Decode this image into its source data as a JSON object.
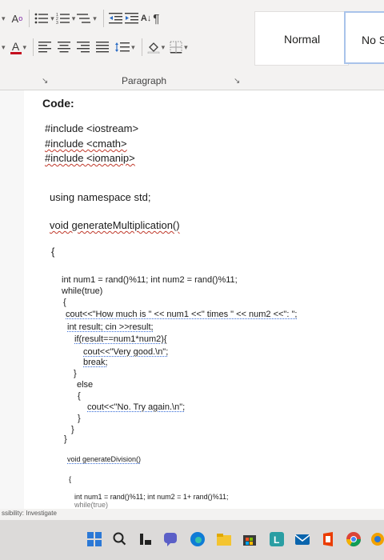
{
  "ribbon": {
    "styles": [
      "Normal",
      "No S"
    ],
    "group_label": "Paragraph",
    "dialog_launcher": "↘",
    "icons": {
      "bullets": "bullets-icon",
      "numbering": "numbering-icon",
      "multilevel": "multilevel-list-icon",
      "decrease_indent": "decrease-indent-icon",
      "increase_indent": "increase-indent-icon",
      "sort": "sort-icon",
      "pilcrow": "show-formatting-icon",
      "align_left": "align-left-icon",
      "center": "align-center-icon",
      "align_right": "align-right-icon",
      "justify": "justify-icon",
      "line_spacing": "line-spacing-icon",
      "shading": "shading-icon",
      "borders": "borders-icon"
    },
    "glyphs": {
      "phonetic": "A",
      "font_color": "A",
      "sort": "A↓",
      "pilcrow": "¶"
    }
  },
  "document": {
    "heading": "Code:",
    "lines": [
      "#include <iostream>",
      "#include <cmath>",
      "#include <iomanip>",
      "using namespace std;",
      "void generateMultiplication()",
      "{",
      "int num1 = rand()%11; int num2 = rand()%11;",
      "while(true)",
      "{",
      "cout<<\"How much is \" << num1 <<\" times \" << num2 <<\": \";",
      "int result; cin >>result;",
      "if(result==num1*num2){",
      "cout<<\"Very good.\\n\";",
      "break;",
      "}",
      "else",
      "{",
      "cout<<\"No. Try again.\\n\";",
      "}",
      "}",
      "}",
      "void generateDivision()",
      "{",
      "int num1 = rand()%11; int num2 = 1+ rand()%11;",
      "while(true)"
    ]
  },
  "status": {
    "text": "ssibility: Investigate"
  },
  "taskbar": {
    "icons": [
      "windows-start-icon",
      "search-icon",
      "task-view-icon",
      "chat-icon",
      "edge-icon",
      "file-explorer-icon",
      "store-icon",
      "app-icon",
      "mail-icon",
      "office-icon",
      "chrome-icon"
    ]
  },
  "colors": {
    "ribbon_bg": "#f3f2f1",
    "font_color_red": "#c50f1f",
    "taskbar_bg": "#dcdad9"
  }
}
